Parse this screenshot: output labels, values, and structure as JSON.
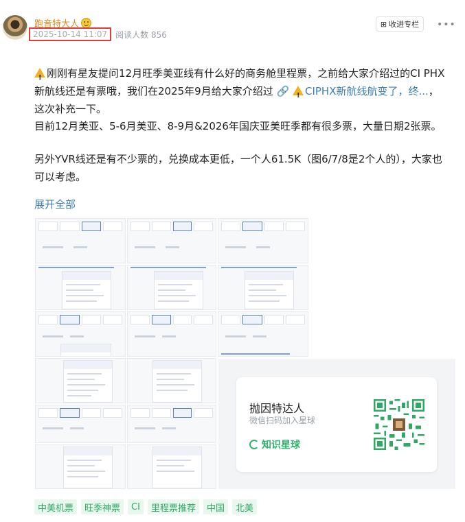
{
  "header": {
    "author": "跑音特大人",
    "date": "2025-10-14 11:07",
    "read_count": "阅读人数 856",
    "follow_button": "收进专栏",
    "more_icon": "ellipsis-icon"
  },
  "content": {
    "p1_a": "刚刚有星友提问12月旺季美亚线有什么好的商务舱里程票，之前给大家介绍过的CI PHX新航线还是有票哦，我们在2025年9月给大家介绍过",
    "p1_link": "CIPHX新航线航变了，终...",
    "p1_b": "，这次补充一下。",
    "p2": "目前12月美亚、5-6月美亚、8-9月&2026年国庆亚美旺季都有很多票，大量日期2张票。",
    "p3": "另外YVR线还是有不少票的，兑换成本更低，一个人61.5K（图6/7/8是2个人的），大家也可以考虑。",
    "expand": "展开全部"
  },
  "qr": {
    "name": "抛因特达人",
    "subtitle": "微信扫码加入星球",
    "brand": "知识星球"
  },
  "tags": [
    "中美机票",
    "旺季神票",
    "CI",
    "里程票推荐",
    "中国",
    "北美"
  ]
}
